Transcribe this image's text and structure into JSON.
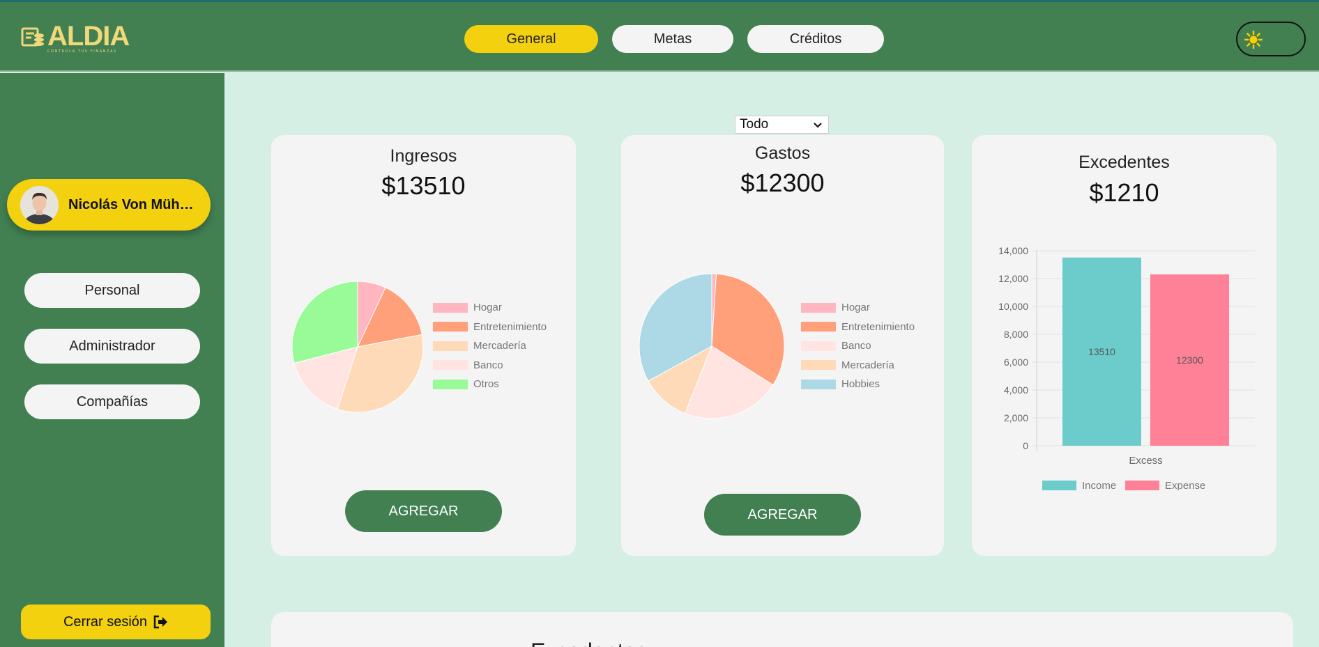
{
  "app": {
    "logo_text": "ALDIA",
    "logo_tagline": "CONTROLA TUS FINANZAS"
  },
  "nav": {
    "tabs": [
      {
        "label": "General",
        "active": true
      },
      {
        "label": "Metas",
        "active": false
      },
      {
        "label": "Créditos",
        "active": false
      }
    ]
  },
  "sidebar": {
    "user_name": "Nicolás Von Müh…",
    "items": [
      {
        "label": "Personal"
      },
      {
        "label": "Administrador"
      },
      {
        "label": "Compañías"
      }
    ],
    "logout_label": "Cerrar sesión"
  },
  "filter": {
    "selected": "Todo"
  },
  "ingresos": {
    "title": "Ingresos",
    "amount": "$13510",
    "add_label": "AGREGAR"
  },
  "gastos": {
    "title": "Gastos",
    "amount": "$12300",
    "add_label": "AGREGAR"
  },
  "excedentes": {
    "title": "Excedentes",
    "amount": "$1210"
  },
  "bottom_section": {
    "title": "Excedentes"
  },
  "colors": {
    "green": "#428052",
    "yellow": "#f3d10e",
    "background": "#d6efe5",
    "card": "#f4f4f4"
  },
  "chart_data": [
    {
      "type": "pie",
      "labels": [
        "Hogar",
        "Entretenimiento",
        "Mercadería",
        "Banco",
        "Otros"
      ],
      "values": [
        7,
        15,
        33,
        16,
        29
      ],
      "colors": [
        "#ffb6c1",
        "#ffa07a",
        "#ffdab9",
        "#ffe4e1",
        "#98fb98"
      ],
      "legend": "right"
    },
    {
      "type": "pie",
      "labels": [
        "Hogar",
        "Entretenimiento",
        "Banco",
        "Mercadería",
        "Hobbies"
      ],
      "values": [
        1,
        33,
        22,
        11,
        33
      ],
      "colors": [
        "#ffb6c1",
        "#ffa07a",
        "#ffe4e1",
        "#ffdab9",
        "#add8e6"
      ],
      "legend": "right"
    },
    {
      "type": "bar",
      "categories": [
        "Excess"
      ],
      "series": [
        {
          "name": "Income",
          "values": [
            13510
          ],
          "color": "#6ccccc"
        },
        {
          "name": "Expense",
          "values": [
            12300
          ],
          "color": "#ff8197"
        }
      ],
      "ylim": [
        0,
        14000
      ],
      "yticks": [
        "0",
        "2,000",
        "4,000",
        "6,000",
        "8,000",
        "10,000",
        "12,000",
        "14,000"
      ],
      "data_labels": [
        "13510",
        "12300"
      ],
      "grid": true,
      "legend": "bottom"
    }
  ]
}
